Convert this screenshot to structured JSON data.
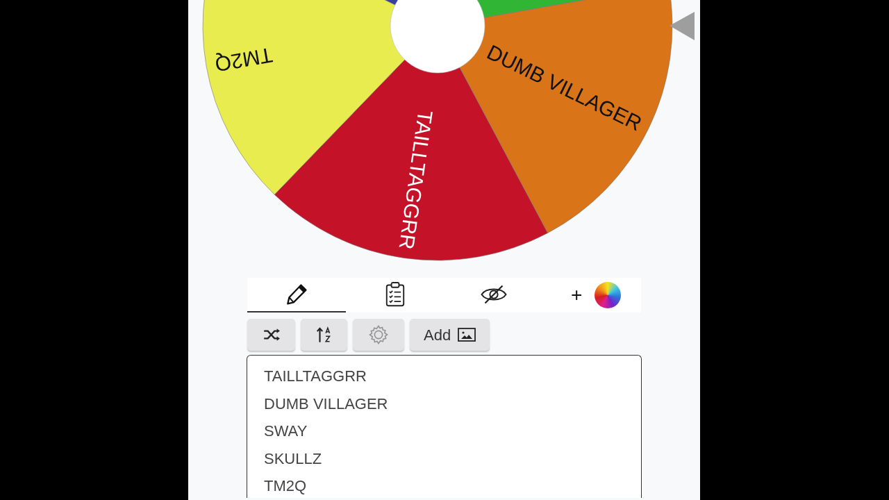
{
  "wheel": {
    "segments": [
      {
        "label": "TAILLTAGGRR",
        "color": "#c41228"
      },
      {
        "label": "DUMB VILLAGER",
        "color": "#d97418"
      },
      {
        "color": "#31b534"
      },
      {
        "color": "#3b3f9c"
      },
      {
        "label": "TM2Q",
        "color": "#e8ec4f"
      }
    ]
  },
  "tabs": [
    {
      "kind": "edit",
      "selected": true
    },
    {
      "kind": "checklist",
      "selected": false
    },
    {
      "kind": "hidden",
      "selected": false
    }
  ],
  "add_color": {
    "label": "+"
  },
  "buttons": [
    {
      "kind": "shuffle",
      "disabled": false
    },
    {
      "kind": "sort",
      "disabled": false
    },
    {
      "kind": "settings",
      "disabled": true
    },
    {
      "kind": "add-image",
      "label": "Add",
      "disabled": false
    }
  ],
  "entries": [
    "TAILLTAGGRR",
    "DUMB VILLAGER",
    "SWAY",
    "SKULLZ",
    "TM2Q"
  ]
}
